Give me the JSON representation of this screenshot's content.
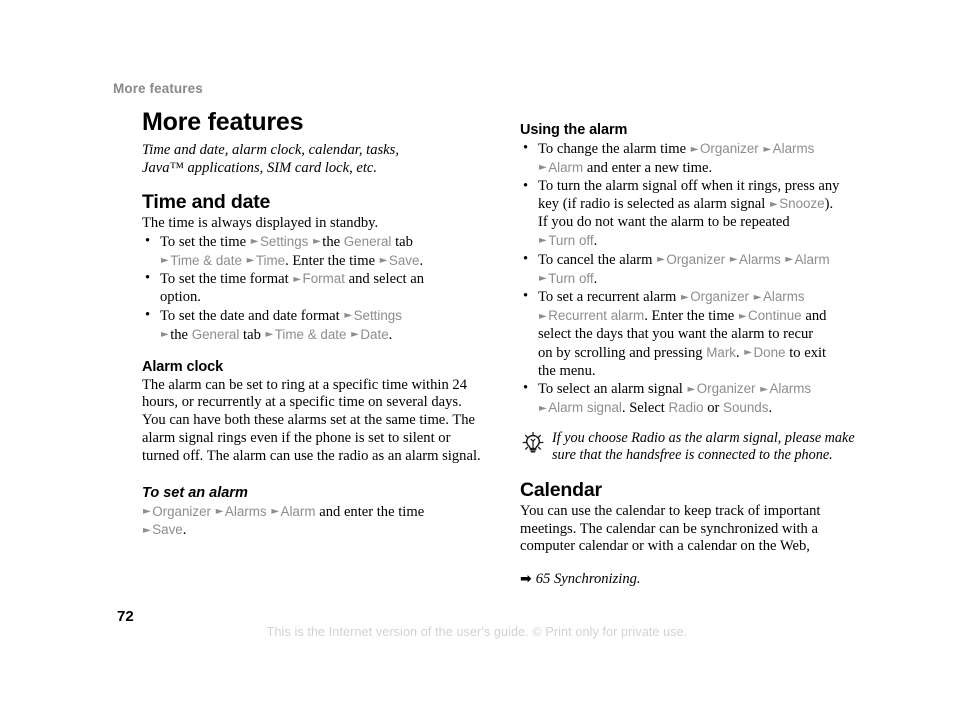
{
  "page": {
    "running_header": "More features",
    "number": "72",
    "footer_note": "This is the Internet version of the user's guide. © Print only for private use.",
    "colors": {
      "menu_path_gray": "#8d8d8d",
      "running_header_gray": "#898989",
      "footer_gray": "#d2d2d2",
      "body_black": "#000000"
    }
  },
  "left_column": {
    "title": "More features",
    "subtitle": "Time and date, alarm clock, calendar, tasks, Java™ applications, SIM card lock, etc.",
    "sections": [
      {
        "heading": "Time and date",
        "intro": "The time is always displayed in standby.",
        "bullets": [
          {
            "runs": [
              {
                "t": "To set the time ",
                "s": "body"
              },
              {
                "t": "►",
                "s": "arrow"
              },
              {
                "t": "Settings ",
                "s": "menu"
              },
              {
                "t": "►",
                "s": "arrow"
              },
              {
                "t": "the ",
                "s": "body"
              },
              {
                "t": "General ",
                "s": "menu"
              },
              {
                "t": "tab",
                "s": "body"
              },
              {
                "t": "\n",
                "s": "break"
              },
              {
                "t": "►",
                "s": "arrow"
              },
              {
                "t": "Time & date ",
                "s": "menu"
              },
              {
                "t": "►",
                "s": "arrow"
              },
              {
                "t": "Time",
                "s": "menu"
              },
              {
                "t": ". Enter the time ",
                "s": "body"
              },
              {
                "t": "►",
                "s": "arrow"
              },
              {
                "t": "Save",
                "s": "menu"
              },
              {
                "t": ".",
                "s": "body"
              }
            ]
          },
          {
            "runs": [
              {
                "t": "To set the time format ",
                "s": "body"
              },
              {
                "t": "►",
                "s": "arrow"
              },
              {
                "t": "Format ",
                "s": "menu"
              },
              {
                "t": "and select an",
                "s": "body"
              },
              {
                "t": "\n",
                "s": "break"
              },
              {
                "t": "option.",
                "s": "body"
              }
            ]
          },
          {
            "runs": [
              {
                "t": "To set the date and date format ",
                "s": "body"
              },
              {
                "t": "►",
                "s": "arrow"
              },
              {
                "t": "Settings",
                "s": "menu"
              },
              {
                "t": "\n",
                "s": "break"
              },
              {
                "t": "►",
                "s": "arrow"
              },
              {
                "t": "the ",
                "s": "body"
              },
              {
                "t": "General ",
                "s": "menu"
              },
              {
                "t": "tab ",
                "s": "body"
              },
              {
                "t": "►",
                "s": "arrow"
              },
              {
                "t": "Time & date ",
                "s": "menu"
              },
              {
                "t": "►",
                "s": "arrow"
              },
              {
                "t": "Date",
                "s": "menu"
              },
              {
                "t": ".",
                "s": "body"
              }
            ]
          }
        ]
      },
      {
        "heading": "Alarm clock",
        "intro": "The alarm can be set to ring at a specific time within 24 hours, or recurrently at a specific time on several days. You can have both these alarms set at the same time. The alarm signal rings even if the phone is set to silent or turned off. The alarm can use the radio as an alarm signal.",
        "subheading": "To set an alarm",
        "path_runs": [
          {
            "t": "►",
            "s": "arrow"
          },
          {
            "t": "Organizer ",
            "s": "menu"
          },
          {
            "t": "►",
            "s": "arrow"
          },
          {
            "t": "Alarms ",
            "s": "menu"
          },
          {
            "t": "►",
            "s": "arrow"
          },
          {
            "t": "Alarm ",
            "s": "menu"
          },
          {
            "t": "and enter the time",
            "s": "body"
          },
          {
            "t": "\n",
            "s": "break"
          },
          {
            "t": "►",
            "s": "arrow"
          },
          {
            "t": "Save",
            "s": "menu"
          },
          {
            "t": ".",
            "s": "body"
          }
        ]
      }
    ]
  },
  "right_column": {
    "alarm_section": {
      "heading": "Using the alarm",
      "bullets": [
        {
          "runs": [
            {
              "t": "To change the alarm time ",
              "s": "body"
            },
            {
              "t": "►",
              "s": "arrow"
            },
            {
              "t": "Organizer ",
              "s": "menu"
            },
            {
              "t": "►",
              "s": "arrow"
            },
            {
              "t": "Alarms",
              "s": "menu"
            },
            {
              "t": "\n",
              "s": "break"
            },
            {
              "t": "►",
              "s": "arrow"
            },
            {
              "t": "Alarm ",
              "s": "menu"
            },
            {
              "t": "and enter a new time.",
              "s": "body"
            }
          ]
        },
        {
          "runs": [
            {
              "t": "To turn the alarm signal off when it rings, press any",
              "s": "body"
            },
            {
              "t": "\n",
              "s": "break"
            },
            {
              "t": "key (if radio is selected as alarm signal ",
              "s": "body"
            },
            {
              "t": "►",
              "s": "arrow"
            },
            {
              "t": "Snooze",
              "s": "menu"
            },
            {
              "t": ").",
              "s": "body"
            },
            {
              "t": "\n",
              "s": "break"
            },
            {
              "t": "If you do not want the alarm to be repeated",
              "s": "body"
            },
            {
              "t": "\n",
              "s": "break"
            },
            {
              "t": "►",
              "s": "arrow"
            },
            {
              "t": "Turn off",
              "s": "menu"
            },
            {
              "t": ".",
              "s": "body"
            }
          ]
        },
        {
          "runs": [
            {
              "t": "To cancel the alarm ",
              "s": "body"
            },
            {
              "t": "►",
              "s": "arrow"
            },
            {
              "t": "Organizer ",
              "s": "menu"
            },
            {
              "t": "►",
              "s": "arrow"
            },
            {
              "t": "Alarms ",
              "s": "menu"
            },
            {
              "t": "►",
              "s": "arrow"
            },
            {
              "t": "Alarm",
              "s": "menu"
            },
            {
              "t": "\n",
              "s": "break"
            },
            {
              "t": "►",
              "s": "arrow"
            },
            {
              "t": "Turn off",
              "s": "menu"
            },
            {
              "t": ".",
              "s": "body"
            }
          ]
        },
        {
          "runs": [
            {
              "t": "To set a recurrent alarm ",
              "s": "body"
            },
            {
              "t": "►",
              "s": "arrow"
            },
            {
              "t": "Organizer ",
              "s": "menu"
            },
            {
              "t": "►",
              "s": "arrow"
            },
            {
              "t": "Alarms",
              "s": "menu"
            },
            {
              "t": "\n",
              "s": "break"
            },
            {
              "t": "►",
              "s": "arrow"
            },
            {
              "t": "Recurrent alarm",
              "s": "menu"
            },
            {
              "t": ". Enter the time ",
              "s": "body"
            },
            {
              "t": "►",
              "s": "arrow"
            },
            {
              "t": "Continue ",
              "s": "menu"
            },
            {
              "t": "and",
              "s": "body"
            },
            {
              "t": "\n",
              "s": "break"
            },
            {
              "t": "select the days that you want the alarm to recur",
              "s": "body"
            },
            {
              "t": "\n",
              "s": "break"
            },
            {
              "t": "on by scrolling and pressing ",
              "s": "body"
            },
            {
              "t": "Mark",
              "s": "menu"
            },
            {
              "t": ". ",
              "s": "body"
            },
            {
              "t": "►",
              "s": "arrow"
            },
            {
              "t": "Done ",
              "s": "menu"
            },
            {
              "t": "to exit",
              "s": "body"
            },
            {
              "t": "\n",
              "s": "break"
            },
            {
              "t": "the menu.",
              "s": "body"
            }
          ]
        },
        {
          "runs": [
            {
              "t": "To select an alarm signal ",
              "s": "body"
            },
            {
              "t": "►",
              "s": "arrow"
            },
            {
              "t": "Organizer ",
              "s": "menu"
            },
            {
              "t": "►",
              "s": "arrow"
            },
            {
              "t": "Alarms",
              "s": "menu"
            },
            {
              "t": "\n",
              "s": "break"
            },
            {
              "t": "►",
              "s": "arrow"
            },
            {
              "t": "Alarm signal",
              "s": "menu"
            },
            {
              "t": ". Select ",
              "s": "body"
            },
            {
              "t": "Radio ",
              "s": "menu"
            },
            {
              "t": "or ",
              "s": "body"
            },
            {
              "t": "Sounds",
              "s": "menu"
            },
            {
              "t": ".",
              "s": "body"
            }
          ]
        }
      ],
      "tip": {
        "icon": "lightbulb-icon",
        "text": "If you choose Radio as the alarm signal, please make sure that the handsfree is connected to the phone."
      }
    },
    "calendar_section": {
      "heading": "Calendar",
      "intro": "You can use the calendar to keep track of important meetings. The calendar can be synchronized with a computer calendar or with a calendar on the Web,",
      "xref_arrow": "➡",
      "xref_text": "65 Synchronizing."
    }
  }
}
